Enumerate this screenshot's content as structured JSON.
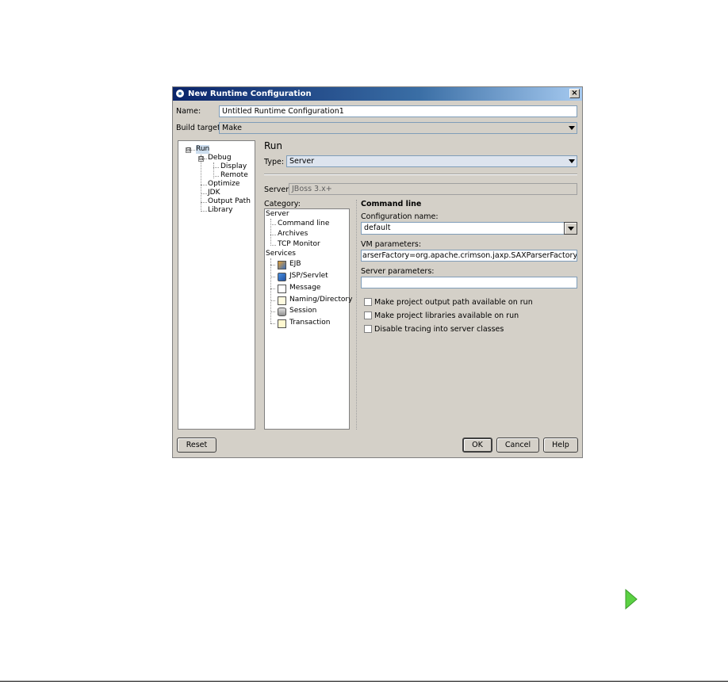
{
  "dialog": {
    "title": "New Runtime Configuration",
    "close_glyph": "×"
  },
  "form": {
    "name_label": "Name:",
    "name_value": "Untitled Runtime Configuration1",
    "build_target_label": "Build target:",
    "build_target_value": "Make"
  },
  "nav_tree": {
    "items": [
      "Run",
      "Debug",
      "Display",
      "Remote",
      "Optimize",
      "JDK",
      "Output Path",
      "Library"
    ],
    "expanders": [
      "⊟",
      "⊟"
    ]
  },
  "run": {
    "heading": "Run",
    "type_label": "Type:",
    "type_value": "Server",
    "server_label": "Server:",
    "server_value": "JBoss 3.x+",
    "category_label": "Category:"
  },
  "category_tree": {
    "groups": [
      "Server",
      "Services"
    ],
    "server_items": [
      "Command line",
      "Archives",
      "TCP Monitor"
    ],
    "service_items": [
      "EJB",
      "JSP/Servlet",
      "Message",
      "Naming/Directory",
      "Session",
      "Transaction"
    ],
    "service_icons": [
      "ejb-icon",
      "jsp-servlet-icon",
      "message-icon",
      "naming-directory-icon",
      "session-icon",
      "transaction-icon"
    ]
  },
  "command_line": {
    "heading": "Command line",
    "config_name_label": "Configuration name:",
    "config_name_value": "default",
    "vm_params_label": "VM parameters:",
    "vm_params_value": "arserFactory=org.apache.crimson.jaxp.SAXParserFactoryImpl",
    "server_params_label": "Server parameters:",
    "server_params_value": "",
    "checkboxes": [
      {
        "label": "Make project output path available on run",
        "checked": false
      },
      {
        "label": "Make project libraries available on run",
        "checked": false
      },
      {
        "label": "Disable tracing into server classes",
        "checked": false
      }
    ]
  },
  "buttons": {
    "reset": "Reset",
    "ok": "OK",
    "cancel": "Cancel",
    "help": "Help"
  },
  "colors": {
    "dialog_bg": "#d4d0c8",
    "titlebar": "#0a246a",
    "field_border": "#7f9db9",
    "play_arrow": "#5bd143"
  }
}
